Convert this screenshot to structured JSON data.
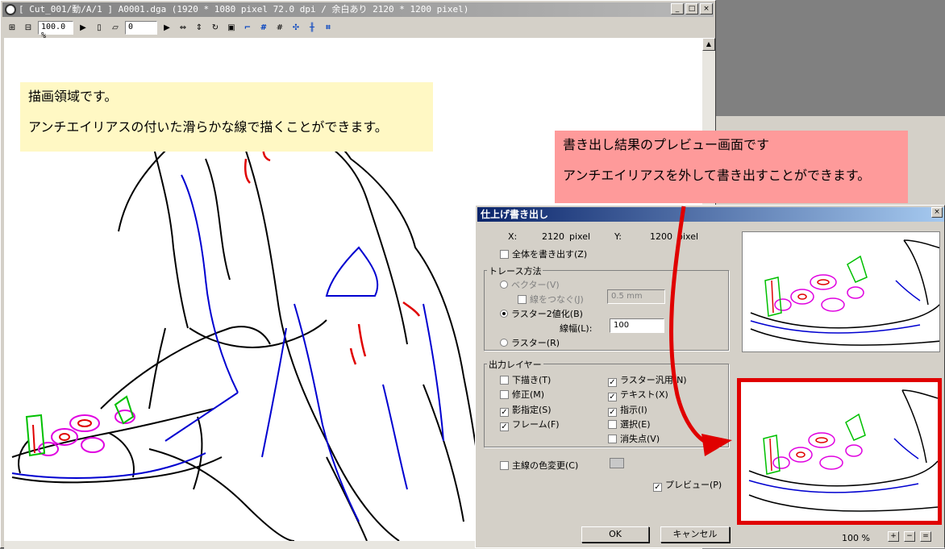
{
  "window": {
    "title": "[ Cut_001/動/A/1 ] A0001.dga (1920 * 1080 pixel 72.0 dpi / 余白あり 2120 * 1200 pixel)",
    "btn_min": "_",
    "btn_max": "□",
    "btn_close": "×"
  },
  "toolbar": {
    "zoom_value": "100.0 %",
    "frame_value": "0"
  },
  "notes": {
    "canvas_line1": "描画領域です。",
    "canvas_line2": "アンチエイリアスの付いた滑らかな線で描くことができます。",
    "preview_line1": "書き出し結果のプレビュー画面です",
    "preview_line2": "アンチエイリアスを外して書き出すことができます。"
  },
  "dialog": {
    "title": "仕上げ書き出し",
    "close": "×",
    "x_label": "X:",
    "x_value": "2120",
    "x_unit": "pixel",
    "y_label": "Y:",
    "y_value": "1200",
    "y_unit": "pixel",
    "export_all": "全体を書き出す(Z)",
    "trace_group": "トレース方法",
    "vector": "ベクター(V)",
    "connect_lines": "線をつなぐ(J)",
    "connect_value": "0.5 mm",
    "raster_binary": "ラスター2値化(B)",
    "line_width_label": "線幅(L):",
    "line_width_value": "100",
    "raster": "ラスター(R)",
    "layer_group": "出力レイヤー",
    "layers_left": [
      {
        "label": "下描き(T)",
        "checked": false
      },
      {
        "label": "修正(M)",
        "checked": false
      },
      {
        "label": "影指定(S)",
        "checked": true
      },
      {
        "label": "フレーム(F)",
        "checked": true
      }
    ],
    "layers_right": [
      {
        "label": "ラスター汎用(N)",
        "checked": true
      },
      {
        "label": "テキスト(X)",
        "checked": true
      },
      {
        "label": "指示(I)",
        "checked": true
      },
      {
        "label": "選択(E)",
        "checked": false
      },
      {
        "label": "消失点(V)",
        "checked": false
      }
    ],
    "main_color": "主線の色変更(C)",
    "preview_check": "プレビュー(P)",
    "ok": "OK",
    "cancel": "キャンセル",
    "zoom_label": "100 %",
    "zoom_plus": "+",
    "zoom_minus": "−",
    "zoom_fit": "="
  },
  "colors": {
    "accent_red": "#e00000",
    "note_yellow": "#fff8c4",
    "note_pink": "#fe9a9a",
    "line_blue": "#0000d0",
    "line_magenta": "#e000e0",
    "line_green": "#00c000"
  }
}
